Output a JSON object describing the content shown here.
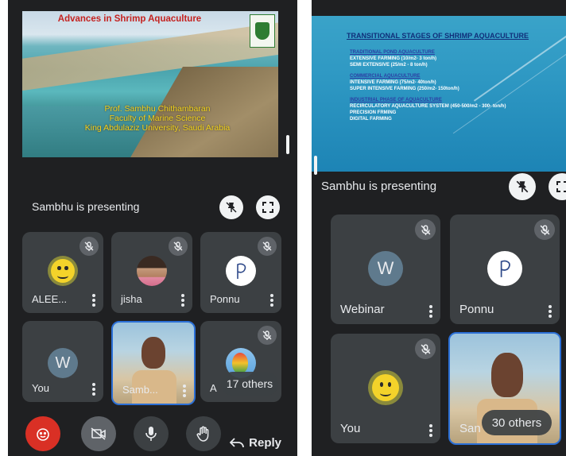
{
  "left": {
    "slide": {
      "title": "Advances in Shrimp Aquaculture",
      "credit_lines": [
        "Prof. Sambhu Chithambaran",
        "Faculty of Marine Science",
        "King Abdulaziz University, Saudi Arabia"
      ]
    },
    "presenting_text": "Sambhu is presenting",
    "participants": [
      {
        "name": "ALEE...",
        "avatar": "smiley-avatar",
        "muted": true
      },
      {
        "name": "jisha",
        "avatar": "photo-avatar",
        "muted": true
      },
      {
        "name": "Ponnu",
        "avatar": "letter-p-avatar",
        "muted": true
      },
      {
        "name": "You",
        "avatar_letter": "W",
        "muted": false
      },
      {
        "name": "Samb...",
        "avatar": "video",
        "muted": false
      },
      {
        "name": "A",
        "avatar": "balloon-avatar",
        "muted": true
      }
    ],
    "others_label": "17 others",
    "reply_label": "Reply"
  },
  "right": {
    "slide": {
      "heading": "TRANSITIONAL STAGES OF SHRIMP AQUACULTURE",
      "sections": [
        {
          "title": "TRADITIONAL POND AQUACULTURE",
          "items": [
            "EXTENSIVE FARMING (10/m2- 3 ton/h)",
            "SEMI EXTENSIVE (25/m2 - 8 ton/h)"
          ]
        },
        {
          "title": "COMMERCIAL AQUACULTURE",
          "items": [
            "INTENSIVE FARMING (75/m2- 40ton/h)",
            "SUPER INTENSIVE FARMING (250/m2- 150ton/h)"
          ]
        },
        {
          "title": "INDUSTRIAL PHASE OF AQUACULTURE",
          "items": [
            "RECIRCULATORY AQUACULTURE SYSTEM (450-500/m2 - 300- ton/h)",
            "PRECISION FRMING",
            "DIGITAL FARMING"
          ]
        }
      ]
    },
    "presenting_text": "Sambhu is presenting",
    "participants": [
      {
        "name": "Webinar",
        "avatar_letter": "W",
        "muted": true
      },
      {
        "name": "Ponnu",
        "avatar": "letter-p-avatar",
        "muted": true
      },
      {
        "name": "You",
        "avatar": "smiley-avatar",
        "muted": true
      },
      {
        "name": "San",
        "avatar": "video",
        "muted": false
      }
    ],
    "others_label": "30 others"
  },
  "colors": {
    "background": "#1f2022",
    "tile": "#3c4043",
    "accent_blue": "#2b6fd6",
    "end_call_red": "#d93025",
    "slide_title_red": "#c5221f",
    "slide_credit_yellow": "#f3d21a"
  },
  "icons": [
    "pin-off-icon",
    "fullscreen-icon",
    "mic-off-icon",
    "more-vert-icon",
    "camera-off-icon",
    "mic-icon",
    "raise-hand-icon",
    "reply-arrow-icon",
    "emoji-icon"
  ]
}
